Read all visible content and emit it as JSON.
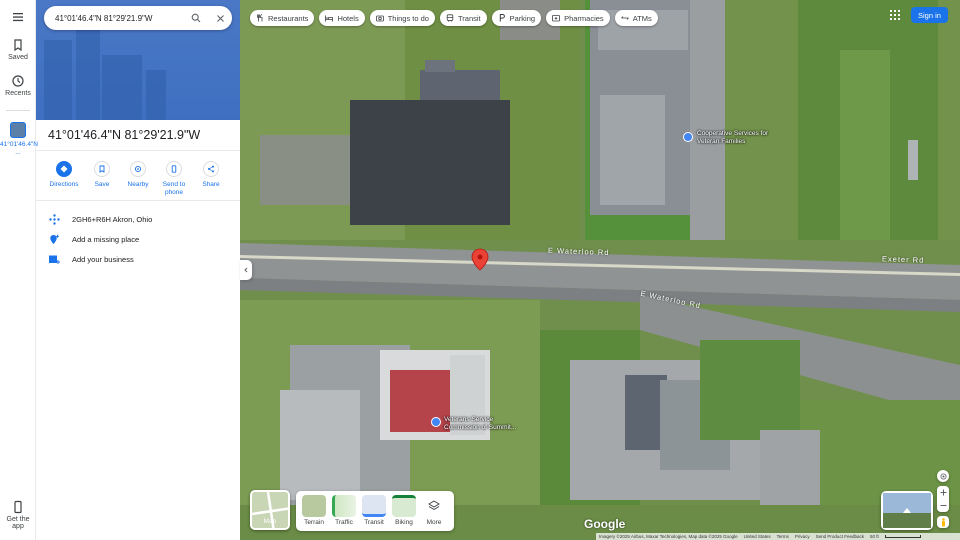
{
  "search": {
    "value": "41°01'46.4\"N 81°29'21.9\"W"
  },
  "rail": {
    "saved": "Saved",
    "recents": "Recents",
    "place": "41°01'46.4\"N ...",
    "get_app": "Get the app"
  },
  "place": {
    "title": "41°01'46.4\"N 81°29'21.9\"W"
  },
  "actions": [
    {
      "label": "Directions",
      "icon": "directions-icon"
    },
    {
      "label": "Save",
      "icon": "bookmark-icon"
    },
    {
      "label": "Nearby",
      "icon": "nearby-icon"
    },
    {
      "label": "Send to phone",
      "icon": "phone-icon"
    },
    {
      "label": "Share",
      "icon": "share-icon"
    }
  ],
  "info": [
    {
      "text": "2GH6+R6H Akron, Ohio",
      "icon": "plus-code-icon"
    },
    {
      "text": "Add a missing place",
      "icon": "add-place-icon"
    },
    {
      "text": "Add your business",
      "icon": "business-icon"
    }
  ],
  "chips": [
    {
      "label": "Restaurants",
      "icon": "restaurant-icon"
    },
    {
      "label": "Hotels",
      "icon": "hotel-icon"
    },
    {
      "label": "Things to do",
      "icon": "camera-icon"
    },
    {
      "label": "Transit",
      "icon": "transit-icon"
    },
    {
      "label": "Parking",
      "icon": "parking-icon"
    },
    {
      "label": "Pharmacies",
      "icon": "pharmacy-icon"
    },
    {
      "label": "ATMs",
      "icon": "atm-icon"
    }
  ],
  "signin": "Sign in",
  "layers": {
    "main": "Map",
    "options": [
      "Terrain",
      "Traffic",
      "Transit",
      "Biking",
      "More"
    ]
  },
  "map_labels": {
    "poi_top": "Cooperative Services for Veteran Families",
    "poi_bottom": "Veterans Service Commission of Summit...",
    "road_upper": "E Waterloo Rd",
    "road_upper_right": "Exeter Rd",
    "road_lower": "E Waterloo Rd"
  },
  "footer": {
    "imagery": "Imagery ©2025 Airbus, Maxar Technologies, Map data ©2025 Google",
    "country": "United States",
    "terms": "Terms",
    "privacy": "Privacy",
    "feedback": "Send Product Feedback",
    "scale": "50 ft"
  },
  "brand": "Google",
  "colors": {
    "accent": "#1a73e8",
    "pin": "#ea4335"
  }
}
